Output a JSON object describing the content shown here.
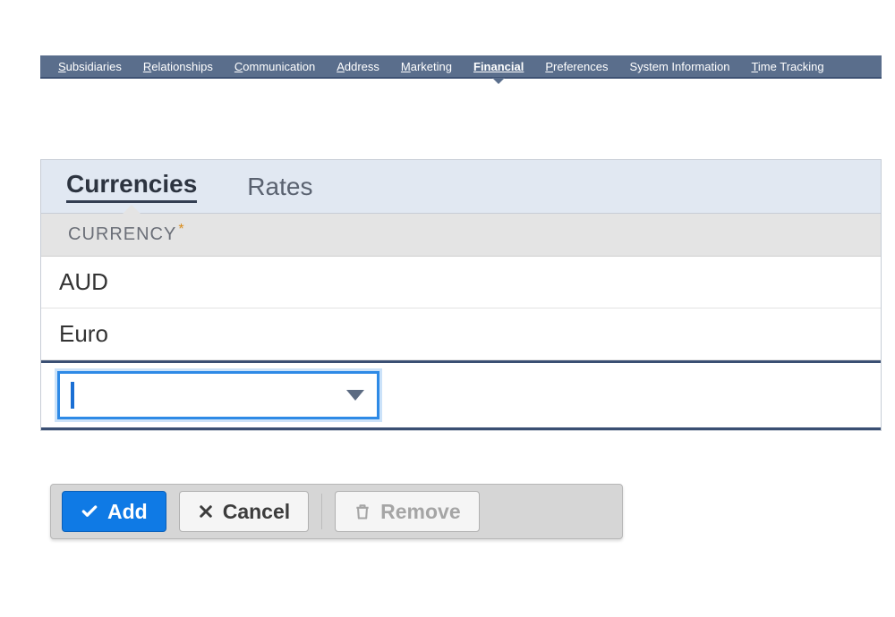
{
  "topnav": {
    "items": [
      {
        "label": "Subsidiaries",
        "accel": "S"
      },
      {
        "label": "Relationships",
        "accel": "R"
      },
      {
        "label": "Communication",
        "accel": "C"
      },
      {
        "label": "Address",
        "accel": "A"
      },
      {
        "label": "Marketing",
        "accel": "M"
      },
      {
        "label": "Financial",
        "accel": "F",
        "active": true
      },
      {
        "label": "Preferences",
        "accel": "P"
      },
      {
        "label": "System Information",
        "accel": ""
      },
      {
        "label": "Time Tracking",
        "accel": "T"
      }
    ]
  },
  "subtabs": {
    "items": [
      {
        "label": "Currencies",
        "active": true
      },
      {
        "label": "Rates",
        "active": false
      }
    ]
  },
  "table": {
    "header": "CURRENCY",
    "required_marker": "*",
    "rows": [
      "AUD",
      "Euro"
    ],
    "edit_value": ""
  },
  "actions": {
    "add": "Add",
    "cancel": "Cancel",
    "remove": "Remove"
  }
}
